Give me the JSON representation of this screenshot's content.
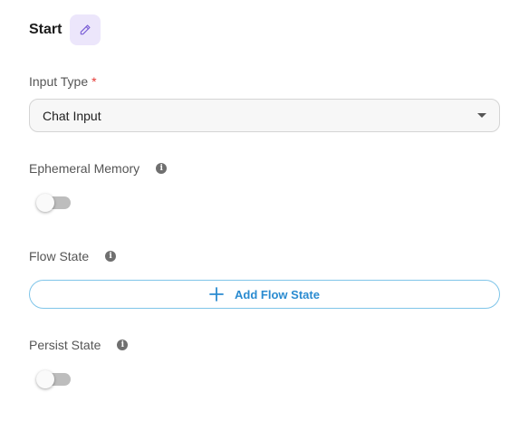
{
  "header": {
    "title": "Start",
    "edit_icon": "pencil-icon"
  },
  "input_type": {
    "label": "Input Type",
    "required_mark": "*",
    "selected": "Chat Input"
  },
  "ephemeral_memory": {
    "label": "Ephemeral Memory",
    "enabled": false
  },
  "flow_state": {
    "label": "Flow State",
    "add_button": "Add Flow State"
  },
  "persist_state": {
    "label": "Persist State",
    "enabled": false
  },
  "colors": {
    "accent": "#2a8bd0",
    "edit_bg": "#ece6fb",
    "required": "#e53935"
  }
}
